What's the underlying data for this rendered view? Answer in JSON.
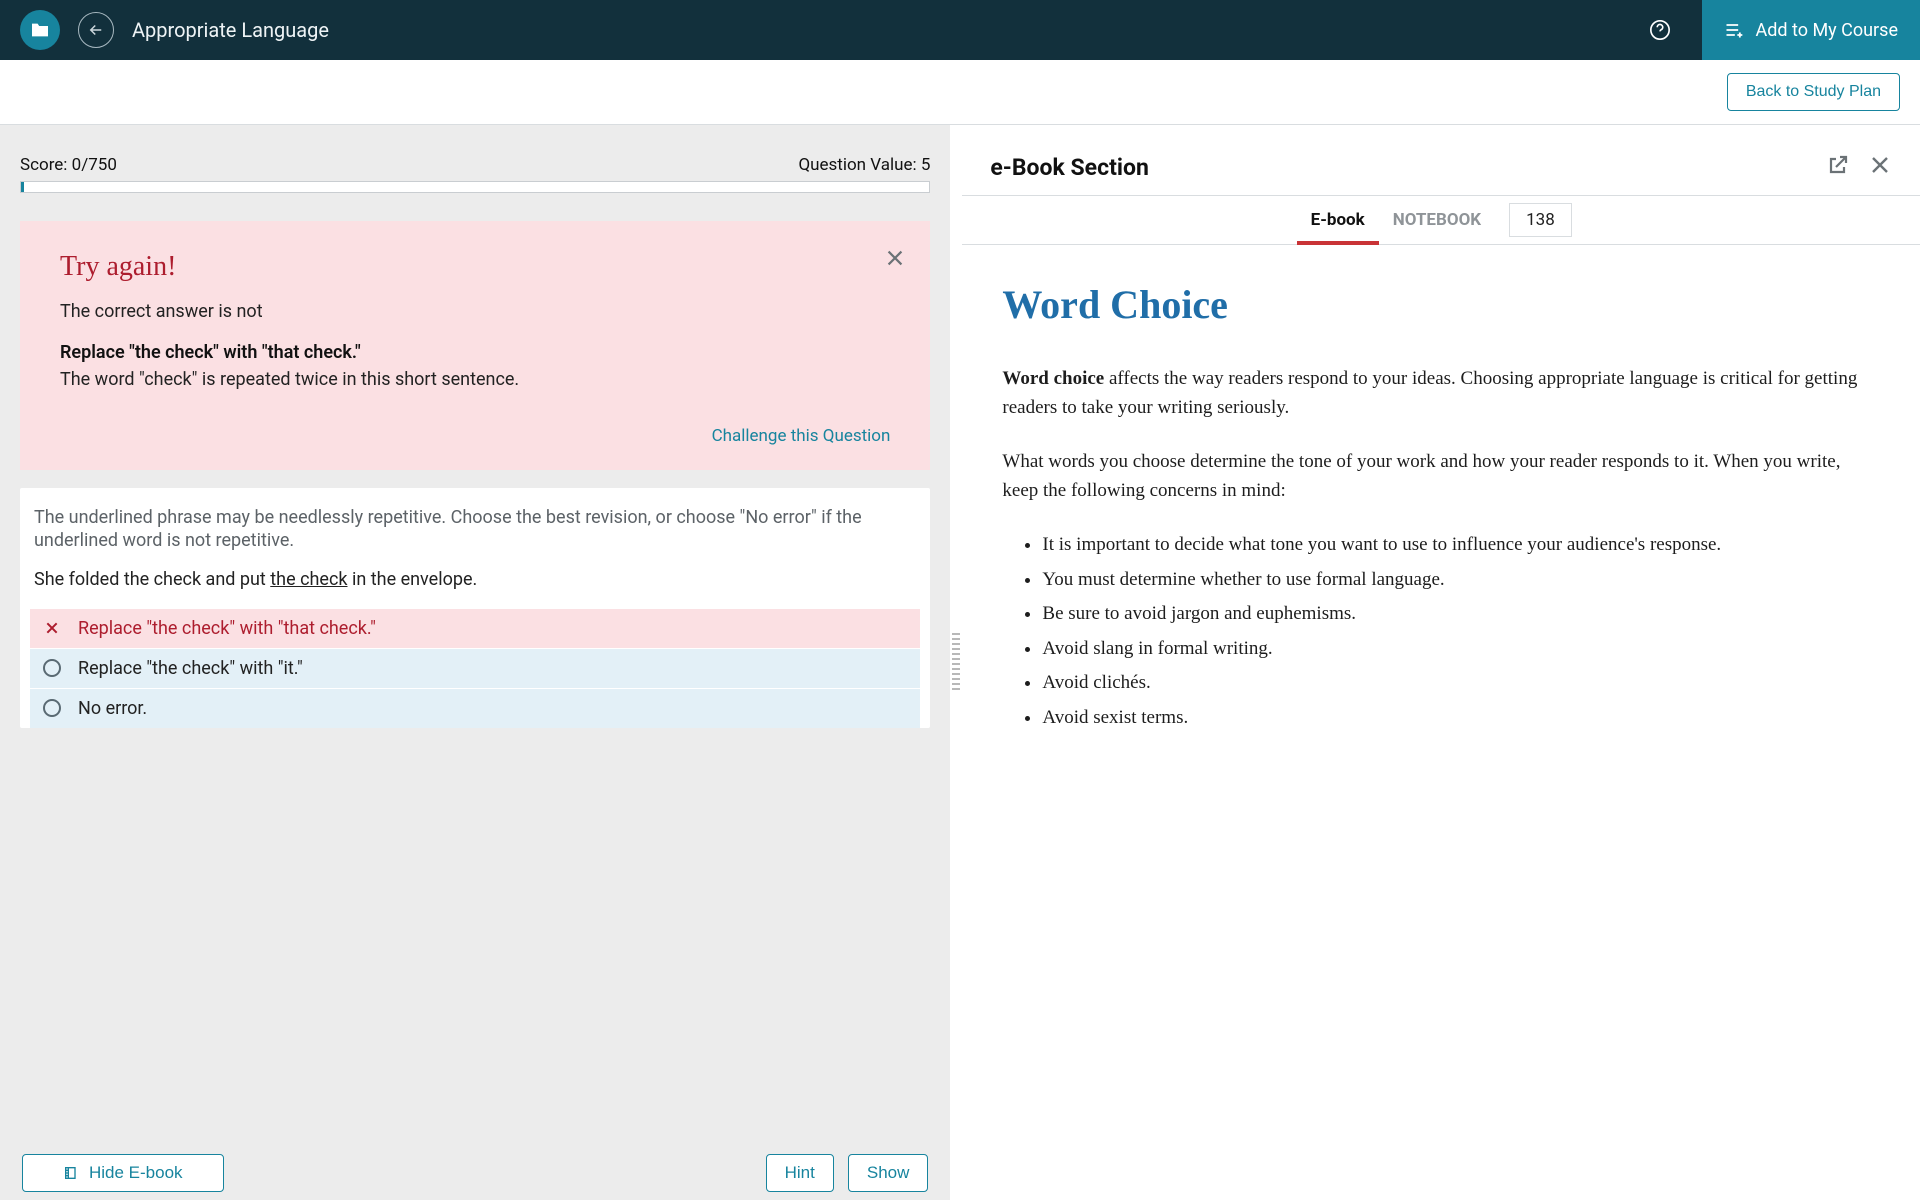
{
  "header": {
    "title": "Appropriate Language",
    "add_course": "Add to My Course"
  },
  "subheader": {
    "back_plan": "Back to Study Plan"
  },
  "quiz": {
    "score_label": "Score: 0/750",
    "question_value": "Question Value: 5",
    "feedback": {
      "title": "Try again!",
      "subtitle": "The correct answer is not",
      "wrong_answer": "Replace \"the check\" with \"that check.\"",
      "explain": "The word \"check\" is repeated twice in this short sentence.",
      "challenge": "Challenge this Question"
    },
    "prompt": "The underlined phrase may be needlessly repetitive. Choose the best revision, or choose \"No error\" if the underlined word is not repetitive.",
    "sentence_prefix": "She folded the check and put ",
    "sentence_underlined": "the check",
    "sentence_suffix": " in the envelope.",
    "choices": [
      {
        "text": "Replace \"the check\" with \"that check.\"",
        "state": "incorrect"
      },
      {
        "text": "Replace \"the check\" with \"it.\"",
        "state": "neutral"
      },
      {
        "text": "No error.",
        "state": "neutral"
      }
    ],
    "actions": {
      "hide_ebook": "Hide E-book",
      "hint": "Hint",
      "show": "Show"
    }
  },
  "ebook": {
    "section_title": "e-Book Section",
    "tabs": {
      "ebook": "E-book",
      "notebook": "NOTEBOOK",
      "page": "138"
    },
    "content": {
      "heading": "Word Choice",
      "p1_strong": "Word choice",
      "p1_rest": " affects the way readers respond to your ideas. Choosing appropriate language is critical for getting readers to take your writing seriously.",
      "p2": "What words you choose determine the tone of your work and how your reader responds to it. When you write, keep the following concerns in mind:",
      "bullets": [
        "It is important to decide what tone you want to use to influence your audience's response.",
        "You must determine whether to use formal language.",
        "Be sure to avoid jargon and euphemisms.",
        "Avoid slang in formal writing.",
        "Avoid clichés.",
        "Avoid sexist terms."
      ]
    }
  }
}
